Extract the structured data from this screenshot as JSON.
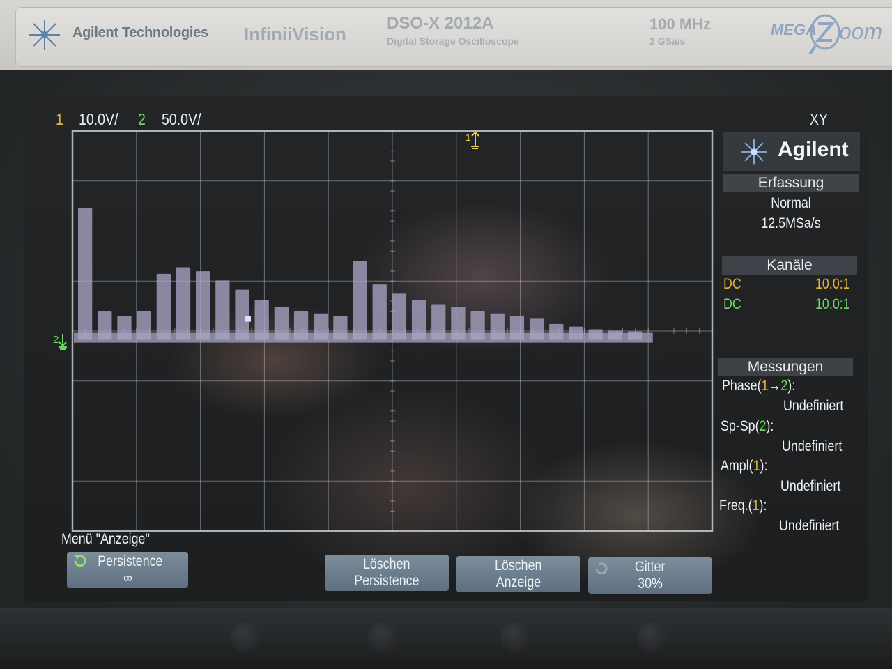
{
  "header": {
    "brand": "Agilent Technologies",
    "product_line": "InfiniiVision",
    "model": "DSO-X 2012A",
    "model_subtitle": "Digital Storage Oscilloscope",
    "bandwidth": "100 MHz",
    "sample_rate": "2 GSa/s",
    "megazoom_prefix": "MEGA",
    "megazoom_suffix": "oom"
  },
  "status_line": {
    "ch1_number": "1",
    "ch1_scale": "10.0V/",
    "ch2_number": "2",
    "ch2_scale": "50.0V/",
    "timebase_mode": "XY"
  },
  "markers": {
    "trigger_marker": "1",
    "ch2_ground_marker": "2"
  },
  "side_panel": {
    "logo_text": "Agilent",
    "acquisition": {
      "title": "Erfassung",
      "mode": "Normal",
      "rate": "12.5MSa/s"
    },
    "channels": {
      "title": "Kanäle",
      "rows": [
        {
          "coupling": "DC",
          "probe": "10.0:1",
          "color": "#e2b63a"
        },
        {
          "coupling": "DC",
          "probe": "10.0:1",
          "color": "#6ed464"
        }
      ]
    },
    "measurements": {
      "title": "Messungen",
      "items": [
        {
          "name_prefix": "Phase(",
          "src_a": "1",
          "arrow": "→",
          "src_b": "2",
          "name_suffix": "):",
          "value": "Undefiniert"
        },
        {
          "name_prefix": "Sp-Sp(",
          "src": "2",
          "name_suffix": "):",
          "value": "Undefiniert"
        },
        {
          "name_prefix": "Ampl(",
          "src": "1",
          "name_suffix": "):",
          "value": "Undefiniert"
        },
        {
          "name_prefix": "Freq.(",
          "src": "1",
          "name_suffix": "):",
          "value": "Undefiniert"
        }
      ]
    }
  },
  "softkeys": {
    "menu_title": "Menü \"Anzeige\"",
    "persistence": {
      "label": "Persistence",
      "value": "∞"
    },
    "clear_persistence": {
      "line1": "Löschen",
      "line2": "Persistence"
    },
    "clear_display": {
      "line1": "Löschen",
      "line2": "Anzeige"
    },
    "grid": {
      "line1": "Gitter",
      "line2": "30%"
    }
  },
  "colors": {
    "ch1": "#e2b63a",
    "ch2": "#6ed464",
    "trace": "#a8a4c4",
    "grid": "#c8ccd0"
  },
  "waveform": {
    "description_free": true,
    "bars_relative_height": [
      1.0,
      0.22,
      0.18,
      0.22,
      0.5,
      0.55,
      0.52,
      0.45,
      0.38,
      0.3,
      0.25,
      0.22,
      0.2,
      0.18,
      0.6,
      0.42,
      0.35,
      0.3,
      0.27,
      0.25,
      0.22,
      0.2,
      0.18,
      0.16,
      0.12,
      0.1,
      0.08,
      0.07,
      0.05
    ]
  }
}
